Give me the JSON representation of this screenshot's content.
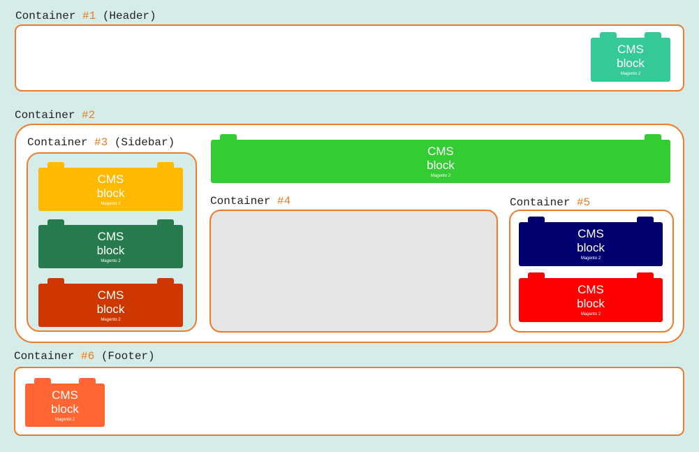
{
  "containers": {
    "c1": {
      "prefix": "Container ",
      "num": "#1",
      "suffix": " (Header)"
    },
    "c2": {
      "prefix": "Container ",
      "num": "#2",
      "suffix": ""
    },
    "c3": {
      "prefix": "Container ",
      "num": "#3",
      "suffix": " (Sidebar)"
    },
    "c4": {
      "prefix": "Container ",
      "num": "#4",
      "suffix": ""
    },
    "c5": {
      "prefix": "Container ",
      "num": "#5",
      "suffix": ""
    },
    "c6": {
      "prefix": "Container ",
      "num": "#6",
      "suffix": " (Footer)"
    }
  },
  "block": {
    "line1": "CMS",
    "line2": "block",
    "line3": "Magento 2"
  },
  "colors": {
    "header_block": "#34c997",
    "sidebar_block_1": "#ffb900",
    "sidebar_block_2": "#267b4c",
    "sidebar_block_3": "#cf3700",
    "main_block": "#33cc33",
    "c5_block_1": "#000070",
    "c5_block_2": "#ff0000",
    "footer_block": "#ff6633",
    "border": "#ee7a2a",
    "number": "#e67e22"
  }
}
